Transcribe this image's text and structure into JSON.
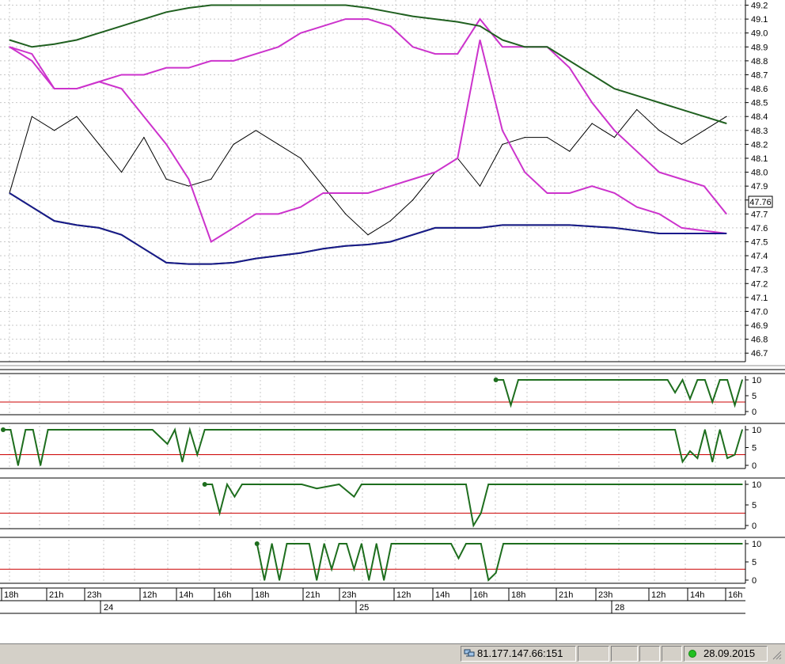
{
  "chart_data": [
    {
      "type": "line",
      "name": "price",
      "y_ticks": [
        "49.2",
        "49.1",
        "49.0",
        "48.9",
        "48.8",
        "48.7",
        "48.6",
        "48.5",
        "48.4",
        "48.3",
        "48.2",
        "48.1",
        "48.0",
        "47.9",
        "47.8",
        "47.7",
        "47.6",
        "47.5",
        "47.4",
        "47.3",
        "47.2",
        "47.1",
        "47.0",
        "46.9",
        "46.8",
        "46.7"
      ],
      "ylim": [
        46.65,
        49.22
      ],
      "last_value_label": "47.76",
      "last_value": 47.76,
      "x_tick_labels": [
        "18h",
        "21h",
        "23h",
        "12h",
        "14h",
        "16h",
        "18h",
        "21h",
        "23h",
        "12h",
        "14h",
        "16h",
        "18h",
        "21h",
        "23h",
        "12h",
        "14h",
        "16h"
      ],
      "day_labels": [
        "24",
        "25",
        "28"
      ],
      "grid": true,
      "x": [
        0,
        3,
        6,
        9,
        12,
        15,
        18,
        21,
        24,
        27,
        30,
        33,
        36,
        39,
        42,
        45,
        48,
        51,
        54,
        57,
        60,
        63,
        66,
        69,
        72,
        75,
        78,
        81,
        84,
        87,
        90,
        93,
        96
      ],
      "series": [
        {
          "color": "#000000",
          "values": [
            47.85,
            48.4,
            48.3,
            48.4,
            48.2,
            48.0,
            48.25,
            47.95,
            47.9,
            47.95,
            48.2,
            48.3,
            48.2,
            48.1,
            47.9,
            47.7,
            47.55,
            47.65,
            47.8,
            48.0,
            48.1,
            47.9,
            48.2,
            48.25,
            48.25,
            48.15,
            48.35,
            48.25,
            48.45,
            48.3,
            48.2,
            48.3,
            48.4
          ]
        },
        {
          "color": "#cc33cc",
          "values": [
            48.9,
            48.8,
            48.6,
            48.6,
            48.65,
            48.6,
            48.4,
            48.2,
            47.95,
            47.5,
            47.6,
            47.7,
            47.7,
            47.75,
            47.85,
            47.85,
            47.85,
            47.9,
            47.95,
            48.0,
            48.1,
            48.95,
            48.3,
            48.0,
            47.85,
            47.85,
            47.9,
            47.85,
            47.75,
            47.7,
            47.6,
            47.58,
            47.56
          ]
        },
        {
          "color": "#cc33cc",
          "values": [
            48.9,
            48.85,
            48.6,
            48.6,
            48.65,
            48.7,
            48.7,
            48.75,
            48.75,
            48.8,
            48.8,
            48.85,
            48.9,
            49.0,
            49.05,
            49.1,
            49.1,
            49.05,
            48.9,
            48.85,
            48.85,
            49.1,
            48.9,
            48.9,
            48.9,
            48.75,
            48.5,
            48.3,
            48.15,
            48.0,
            47.95,
            47.9,
            47.7
          ]
        },
        {
          "color": "#206020",
          "values": [
            48.95,
            48.9,
            48.92,
            48.95,
            49.0,
            49.05,
            49.1,
            49.15,
            49.18,
            49.2,
            49.2,
            49.2,
            49.2,
            49.2,
            49.2,
            49.2,
            49.18,
            49.15,
            49.12,
            49.1,
            49.08,
            49.05,
            48.95,
            48.9,
            48.9,
            48.8,
            48.7,
            48.6,
            48.55,
            48.5,
            48.45,
            48.4,
            48.35
          ]
        },
        {
          "color": "#206020",
          "values": [
            47.85,
            47.75,
            47.65,
            47.62,
            47.6,
            47.55,
            47.45,
            47.35,
            47.34,
            47.34,
            47.35,
            47.38,
            47.4,
            47.42,
            47.45,
            47.47,
            47.48,
            47.5,
            47.55,
            47.6,
            47.6,
            47.6,
            47.62,
            47.62,
            47.62,
            47.62,
            47.61,
            47.6,
            47.58,
            47.56,
            47.56,
            47.56,
            47.56
          ]
        },
        {
          "color": "#1a1a8c",
          "values": [
            47.85,
            47.75,
            47.65,
            47.62,
            47.6,
            47.55,
            47.45,
            47.35,
            47.34,
            47.34,
            47.35,
            47.38,
            47.4,
            47.42,
            47.45,
            47.47,
            47.48,
            47.5,
            47.55,
            47.6,
            47.6,
            47.6,
            47.62,
            47.62,
            47.62,
            47.62,
            47.61,
            47.6,
            47.58,
            47.56,
            47.56,
            47.56,
            47.56
          ]
        }
      ]
    },
    {
      "type": "line",
      "y_ticks": [
        "10",
        "5",
        "0"
      ],
      "ylim": [
        0,
        10
      ],
      "reference_line": 3,
      "series": [
        {
          "color": "#1e6e1e",
          "x": [
            66,
            67,
            68,
            69,
            70,
            72,
            75,
            80,
            85,
            89,
            90,
            91,
            92,
            93,
            94,
            95,
            96,
            97,
            98,
            99
          ],
          "values": [
            10,
            10,
            2,
            10,
            10,
            10,
            10,
            10,
            10,
            10,
            6,
            10,
            4,
            10,
            10,
            3,
            10,
            10,
            2,
            10
          ]
        }
      ]
    },
    {
      "type": "line",
      "y_ticks": [
        "10",
        "5",
        "0"
      ],
      "ylim": [
        0,
        10
      ],
      "reference_line": 3,
      "series": [
        {
          "color": "#1e6e1e",
          "x": [
            0,
            1,
            2,
            3,
            4,
            5,
            6,
            7,
            8,
            10,
            20,
            22,
            23,
            24,
            25,
            26,
            27,
            28,
            30,
            50,
            90,
            91,
            92,
            93,
            94,
            95,
            96,
            97,
            98,
            99
          ],
          "values": [
            10,
            10,
            0,
            10,
            10,
            0,
            10,
            10,
            10,
            10,
            10,
            6,
            10,
            1,
            10,
            3,
            10,
            10,
            10,
            10,
            10,
            1,
            4,
            2,
            10,
            1,
            10,
            2,
            3,
            10
          ]
        }
      ]
    },
    {
      "type": "line",
      "y_ticks": [
        "10",
        "5",
        "0"
      ],
      "ylim": [
        0,
        10
      ],
      "reference_line": 3,
      "series": [
        {
          "color": "#1e6e1e",
          "x": [
            27,
            28,
            29,
            30,
            31,
            32,
            33,
            35,
            40,
            42,
            45,
            47,
            48,
            49,
            50,
            55,
            60,
            62,
            63,
            64,
            65,
            66,
            70,
            80,
            99
          ],
          "values": [
            10,
            10,
            3,
            10,
            7,
            10,
            10,
            10,
            10,
            9,
            10,
            7,
            10,
            10,
            10,
            10,
            10,
            10,
            0,
            3,
            10,
            10,
            10,
            10,
            10
          ]
        }
      ]
    },
    {
      "type": "line",
      "y_ticks": [
        "10",
        "5",
        "0"
      ],
      "ylim": [
        0,
        10
      ],
      "reference_line": 3,
      "series": [
        {
          "color": "#1e6e1e",
          "x": [
            34,
            35,
            36,
            37,
            38,
            40,
            41,
            42,
            43,
            44,
            45,
            46,
            47,
            48,
            49,
            50,
            51,
            52,
            53,
            55,
            60,
            61,
            62,
            64,
            65,
            66,
            67,
            70,
            80,
            99
          ],
          "values": [
            10,
            0,
            10,
            0,
            10,
            10,
            10,
            0,
            10,
            3,
            10,
            10,
            3,
            10,
            0,
            10,
            0,
            10,
            10,
            10,
            10,
            6,
            10,
            10,
            0,
            2,
            10,
            10,
            10,
            10
          ]
        }
      ]
    }
  ],
  "status_bar": {
    "connection": "81.177.147.66:151",
    "date": "28.09.2015"
  }
}
